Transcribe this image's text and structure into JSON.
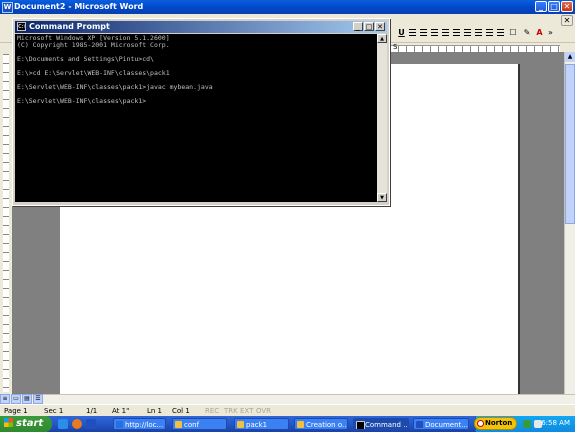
{
  "word": {
    "title": "Document2 - Microsoft Word",
    "controls": {
      "minimize": "_",
      "maximize": "□",
      "close": "✕"
    }
  },
  "toolbar": {
    "underline": "U",
    "font_color_label": "A"
  },
  "ruler": {
    "marker": "S"
  },
  "statusbar": {
    "page": "Page  1",
    "sec": "Sec  1",
    "pages": "1/1",
    "at": "At  1\"",
    "ln": "Ln  1",
    "col": "Col  1",
    "rec": "REC",
    "trk": "TRK",
    "ext": "EXT",
    "ovr": "OVR"
  },
  "cmd": {
    "title": "Command Prompt",
    "lines": [
      "Microsoft Windows XP [Version 5.1.2600]",
      "(C) Copyright 1985-2001 Microsoft Corp.",
      "",
      "E:\\Documents and Settings\\Pintu>cd\\",
      "",
      "E:\\>cd E:\\Servlet\\WEB-INF\\classes\\pack1",
      "",
      "E:\\Servlet\\WEB-INF\\classes\\pack1>javac mybean.java",
      "",
      "E:\\Servlet\\WEB-INF\\classes\\pack1>"
    ]
  },
  "taskbar": {
    "start": "start",
    "tasks": [
      {
        "label": "http://loc...",
        "color": "#2a6fe0"
      },
      {
        "label": "conf",
        "color": "#f0c040"
      },
      {
        "label": "pack1",
        "color": "#f0c040"
      },
      {
        "label": "Creation o...",
        "color": "#f0c040"
      },
      {
        "label": "Command ...",
        "color": "#000000"
      },
      {
        "label": "Document...",
        "color": "#2050c0"
      }
    ],
    "norton": "Norton",
    "clock": "6:58 AM"
  }
}
